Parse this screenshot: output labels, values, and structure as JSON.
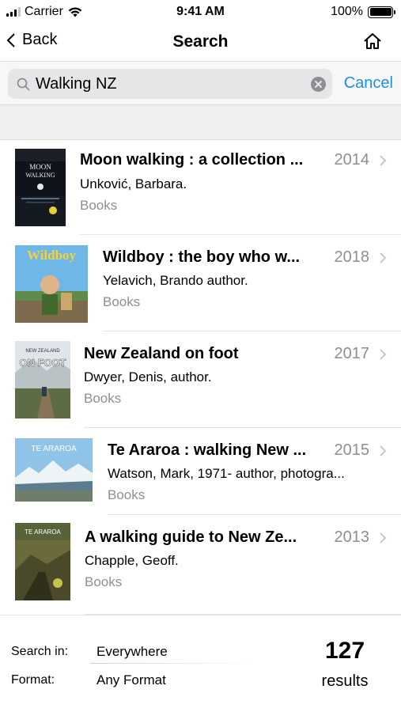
{
  "status_bar": {
    "carrier": "Carrier",
    "time": "9:41 AM",
    "battery": "100%",
    "battery_level": 1.0
  },
  "nav": {
    "back_label": "Back",
    "title": "Search",
    "home_icon": "home-icon"
  },
  "search": {
    "value": "Walking NZ",
    "cancel_label": "Cancel"
  },
  "results": [
    {
      "title": "Moon walking : a collection ...",
      "year": "2014",
      "author": "Unković, Barbara.",
      "type": "Books"
    },
    {
      "title": "Wildboy : the boy who w...",
      "year": "2018",
      "author": "Yelavich, Brando author.",
      "type": "Books"
    },
    {
      "title": "New Zealand on foot",
      "year": "2017",
      "author": "Dwyer, Denis, author.",
      "type": "Books"
    },
    {
      "title": "Te Araroa : walking New ...",
      "year": "2015",
      "author": "Watson, Mark, 1971- author, photogra...",
      "type": "Books"
    },
    {
      "title": "A walking guide to New Ze...",
      "year": "2013",
      "author": "Chapple, Geoff.",
      "type": "Books"
    }
  ],
  "covers": {
    "moon": {
      "line1": "MOON",
      "line2": "WALKING"
    },
    "wildboy": {
      "title": "Wildboy"
    },
    "nzfoot": {
      "small": "NEW ZEALAND",
      "title": "ON FOOT"
    },
    "teararoa": {
      "title": "TE ARAROA"
    },
    "guide": {
      "title": "TE ARAROA"
    }
  },
  "filters": {
    "search_in_label": "Search in:",
    "search_in_value": "Everywhere",
    "format_label": "Format:",
    "format_value": "Any Format",
    "count": "127",
    "count_label": "results"
  },
  "colors": {
    "accent": "#1a8fe3",
    "secondary_text": "#8e8e93"
  }
}
